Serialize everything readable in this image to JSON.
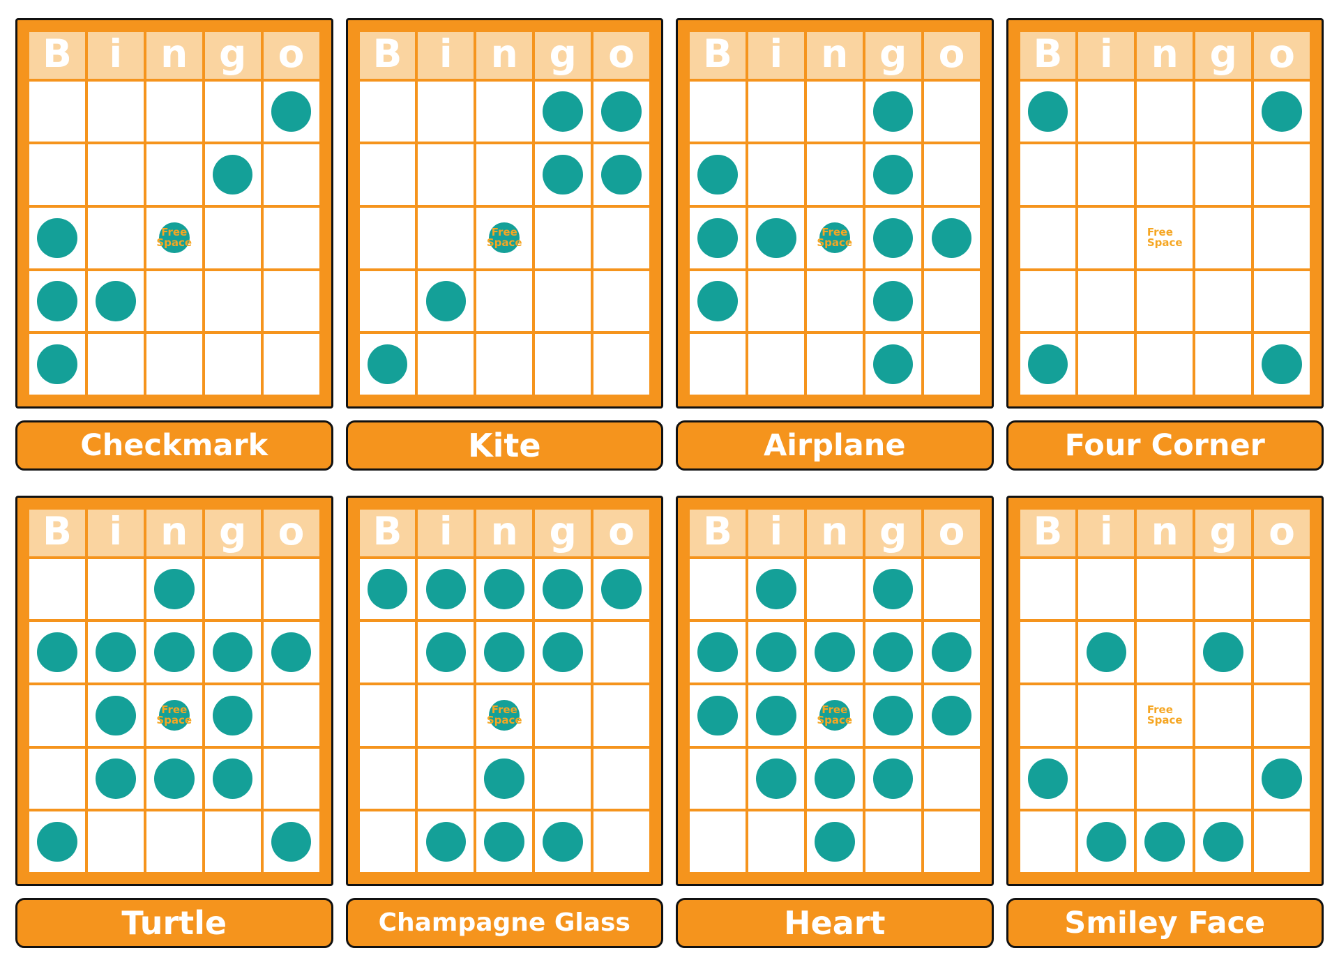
{
  "free_space_text": "Free\nSpace",
  "colors": {
    "card_border_orange": "#F5941D",
    "header_band": "#FAD4A0",
    "dot_teal": "#14A098",
    "free_text_orange": "#F5A623",
    "outline_black": "#111111",
    "cell_white": "#FFFFFF"
  },
  "columns": [
    "B",
    "i",
    "n",
    "g",
    "o"
  ],
  "cards": [
    {
      "label": "Checkmark",
      "label_size": "size-lg",
      "free_filled": true,
      "marks": [
        [
          false,
          false,
          false,
          false,
          true
        ],
        [
          false,
          false,
          false,
          true,
          false
        ],
        [
          true,
          false,
          false,
          false,
          false
        ],
        [
          true,
          true,
          false,
          false,
          false
        ],
        [
          true,
          false,
          false,
          false,
          false
        ]
      ]
    },
    {
      "label": "Kite",
      "label_size": "size-xl",
      "free_filled": true,
      "marks": [
        [
          false,
          false,
          false,
          true,
          true
        ],
        [
          false,
          false,
          false,
          true,
          true
        ],
        [
          false,
          false,
          false,
          false,
          false
        ],
        [
          false,
          true,
          false,
          false,
          false
        ],
        [
          true,
          false,
          false,
          false,
          false
        ]
      ]
    },
    {
      "label": "Airplane",
      "label_size": "size-lg",
      "free_filled": true,
      "marks": [
        [
          false,
          false,
          false,
          true,
          false
        ],
        [
          true,
          false,
          false,
          true,
          false
        ],
        [
          true,
          true,
          false,
          true,
          true
        ],
        [
          true,
          false,
          false,
          true,
          false
        ],
        [
          false,
          false,
          false,
          true,
          false
        ]
      ]
    },
    {
      "label": "Four Corner",
      "label_size": "size-lg",
      "free_filled": false,
      "marks": [
        [
          true,
          false,
          false,
          false,
          true
        ],
        [
          false,
          false,
          false,
          false,
          false
        ],
        [
          false,
          false,
          false,
          false,
          false
        ],
        [
          false,
          false,
          false,
          false,
          false
        ],
        [
          true,
          false,
          false,
          false,
          true
        ]
      ]
    },
    {
      "label": "Turtle",
      "label_size": "size-xl",
      "free_filled": true,
      "marks": [
        [
          false,
          false,
          true,
          false,
          false
        ],
        [
          true,
          true,
          true,
          true,
          true
        ],
        [
          false,
          true,
          false,
          true,
          false
        ],
        [
          false,
          true,
          true,
          true,
          false
        ],
        [
          true,
          false,
          false,
          false,
          true
        ]
      ]
    },
    {
      "label": "Champagne Glass",
      "label_size": "size-md",
      "free_filled": true,
      "marks": [
        [
          true,
          true,
          true,
          true,
          true
        ],
        [
          false,
          true,
          true,
          true,
          false
        ],
        [
          false,
          false,
          false,
          false,
          false
        ],
        [
          false,
          false,
          true,
          false,
          false
        ],
        [
          false,
          true,
          true,
          true,
          false
        ]
      ]
    },
    {
      "label": "Heart",
      "label_size": "size-xl",
      "free_filled": true,
      "marks": [
        [
          false,
          true,
          false,
          true,
          false
        ],
        [
          true,
          true,
          true,
          true,
          true
        ],
        [
          true,
          true,
          false,
          true,
          true
        ],
        [
          false,
          true,
          true,
          true,
          false
        ],
        [
          false,
          false,
          true,
          false,
          false
        ]
      ]
    },
    {
      "label": "Smiley Face",
      "label_size": "size-lg",
      "free_filled": false,
      "marks": [
        [
          false,
          false,
          false,
          false,
          false
        ],
        [
          false,
          true,
          false,
          true,
          false
        ],
        [
          false,
          false,
          false,
          false,
          false
        ],
        [
          true,
          false,
          false,
          false,
          true
        ],
        [
          false,
          true,
          true,
          true,
          false
        ]
      ]
    }
  ]
}
